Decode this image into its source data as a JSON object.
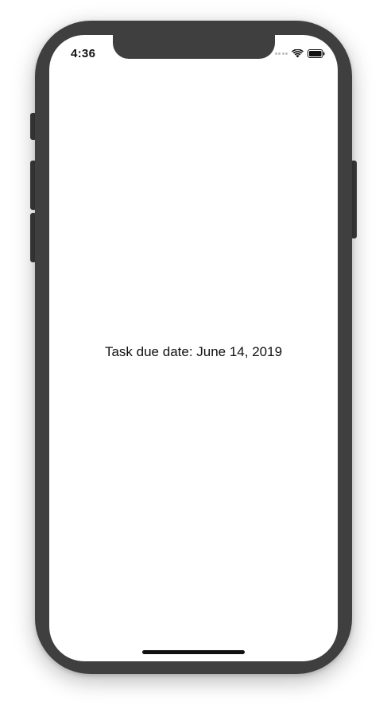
{
  "status_bar": {
    "time": "4:36",
    "signal_icon": "cellular-signal-icon",
    "wifi_icon": "wifi-icon",
    "battery_icon": "battery-icon"
  },
  "content": {
    "due_date_text": "Task due date: June 14, 2019"
  },
  "device": {
    "frame_color": "#3f3f3f",
    "screen_color": "#ffffff"
  }
}
